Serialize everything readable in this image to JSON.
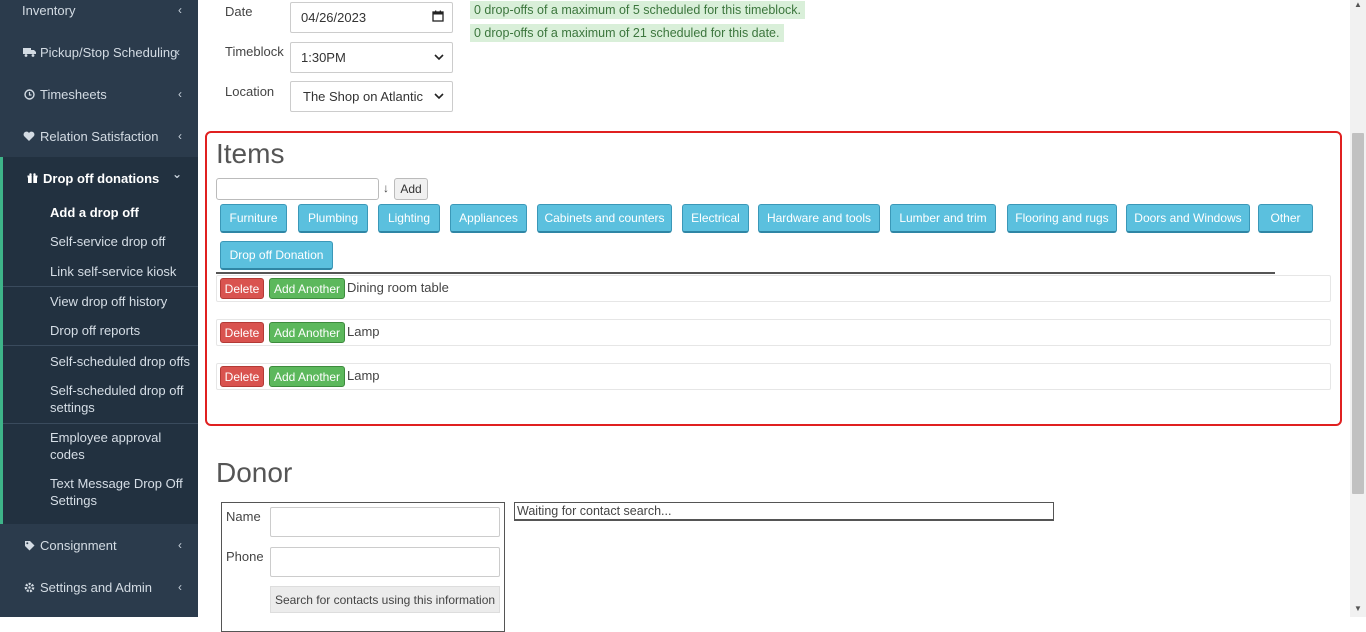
{
  "sidebar": {
    "inventory": "Inventory",
    "pickup": "Pickup/Stop Scheduling",
    "timesheets": "Timesheets",
    "relation": "Relation Satisfaction",
    "dropoff": "Drop off donations",
    "consignment": "Consignment",
    "settings": "Settings and Admin",
    "sub_items": [
      "Add a drop off",
      "Self-service drop off",
      "Link self-service kiosk",
      "View drop off history",
      "Drop off reports",
      "Self-scheduled drop offs",
      "Self-scheduled drop off settings",
      "Employee approval codes",
      "Text Message Drop Off Settings"
    ],
    "chevron_left": "‹",
    "chevron_down": "⌄"
  },
  "form": {
    "date_label": "Date",
    "date_value": "04/26/2023",
    "timeblock_label": "Timeblock",
    "timeblock_value": "1:30PM",
    "location_label": "Location",
    "location_value": "The Shop on Atlantic",
    "notice_timeblock": "0 drop-offs of a maximum of 5 scheduled for this timeblock.",
    "notice_date": "0 drop-offs of a maximum of 21 scheduled for this date."
  },
  "items": {
    "heading": "Items",
    "arrow": "↓",
    "add_label": "Add",
    "categories": [
      "Furniture",
      "Plumbing",
      "Lighting",
      "Appliances",
      "Cabinets and counters",
      "Electrical",
      "Hardware and tools",
      "Lumber and trim",
      "Flooring and rugs",
      "Doors and Windows",
      "Other",
      "Drop off Donation"
    ],
    "delete_label": "Delete",
    "add_another_label": "Add Another",
    "rows": [
      {
        "name": "Dining room table"
      },
      {
        "name": "Lamp"
      },
      {
        "name": "Lamp"
      }
    ]
  },
  "donor": {
    "heading": "Donor",
    "name_label": "Name",
    "phone_label": "Phone",
    "search_button": "Search for contacts using this information",
    "waiting_text": "Waiting for contact search..."
  },
  "colors": {
    "sidebar_bg": "#2b3b4c",
    "accent_green": "#3eb489",
    "category_blue": "#5bc0de",
    "delete_red": "#d9534f",
    "add_green": "#5cb85c",
    "highlight_red": "#e02020"
  }
}
